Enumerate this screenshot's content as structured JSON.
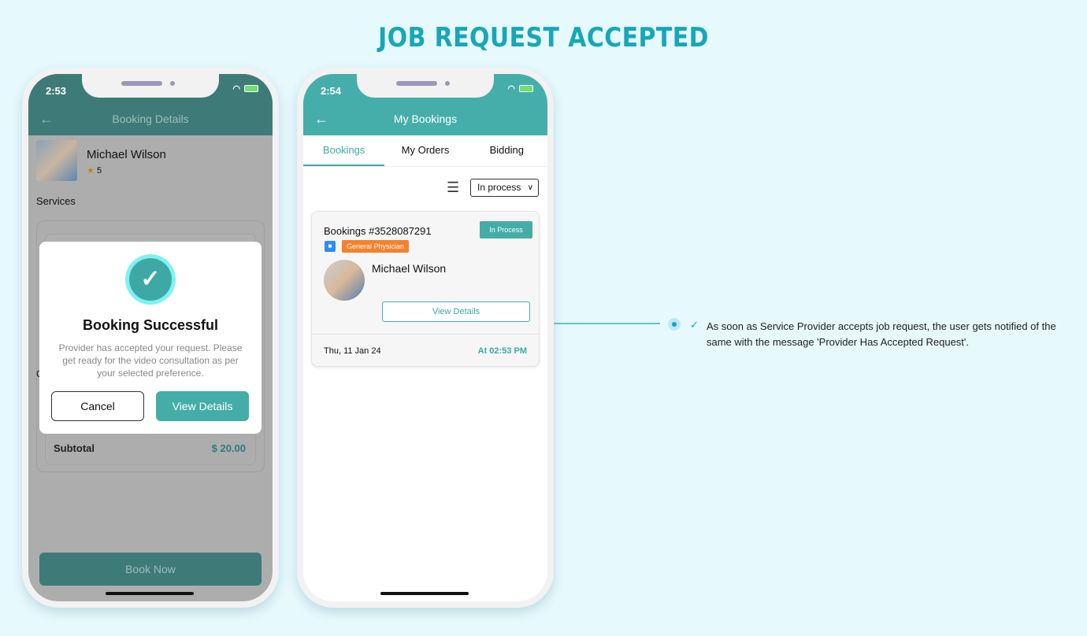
{
  "page": {
    "title": "JOB REQUEST ACCEPTED"
  },
  "phone1": {
    "status_time": "2:53",
    "app_title": "Booking Details",
    "provider": {
      "name": "Michael Wilson",
      "rating": "5"
    },
    "services_label": "Services",
    "partial_label": "C",
    "subtotal_label": "Subtotal",
    "subtotal_value": "$ 20.00",
    "book_now": "Book Now",
    "modal": {
      "title": "Booking Successful",
      "message": "Provider has accepted your request. Please get ready for the video consultation as per your selected preference.",
      "cancel": "Cancel",
      "view_details": "View Details"
    }
  },
  "phone2": {
    "status_time": "2:54",
    "app_title": "My Bookings",
    "tabs": [
      {
        "label": "Bookings",
        "active": true
      },
      {
        "label": "My Orders",
        "active": false
      },
      {
        "label": "Bidding",
        "active": false
      }
    ],
    "filter_value": "In process",
    "booking": {
      "id": "Bookings #3528087291",
      "status": "In Process",
      "specialty": "General Physician",
      "provider": "Michael Wilson",
      "view_details": "View Details",
      "date": "Thu, 11 Jan 24",
      "time": "At 02:53 PM"
    }
  },
  "annotation": {
    "text": "As soon as Service Provider accepts job request, the user gets notified of the same with the message 'Provider Has Accepted Request'."
  },
  "colors": {
    "accent": "#46aeaa",
    "title": "#16a7b8",
    "tag": "#f5812a"
  }
}
